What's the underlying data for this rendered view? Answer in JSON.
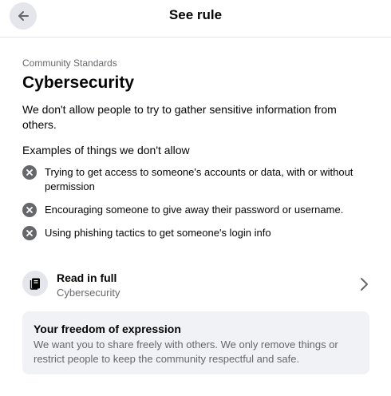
{
  "header": {
    "title": "See rule",
    "back_icon": "arrow-left-icon"
  },
  "rule": {
    "section": "Community Standards",
    "title": "Cybersecurity",
    "description": "We don't allow people to try to gather sensitive information from others.",
    "examples_heading": "Examples of things we don't allow",
    "examples": [
      "Trying to get access to someone's accounts or data, with or without permission",
      "Encouraging someone to give away their password or username.",
      "Using phishing tactics to get someone's login info"
    ]
  },
  "read_full": {
    "icon": "book-icon",
    "title": "Read in full",
    "subtitle": "Cybersecurity",
    "chevron_icon": "chevron-right-icon"
  },
  "freedom": {
    "title": "Your freedom of expression",
    "body": "We want you to share freely with others. We only remove things or restrict people to keep the community respectful and safe."
  },
  "colors": {
    "primary_text": "#050505",
    "secondary_text": "#65676b",
    "icon_bg": "#e4e6eb",
    "card_bg": "#f0f2f5"
  }
}
